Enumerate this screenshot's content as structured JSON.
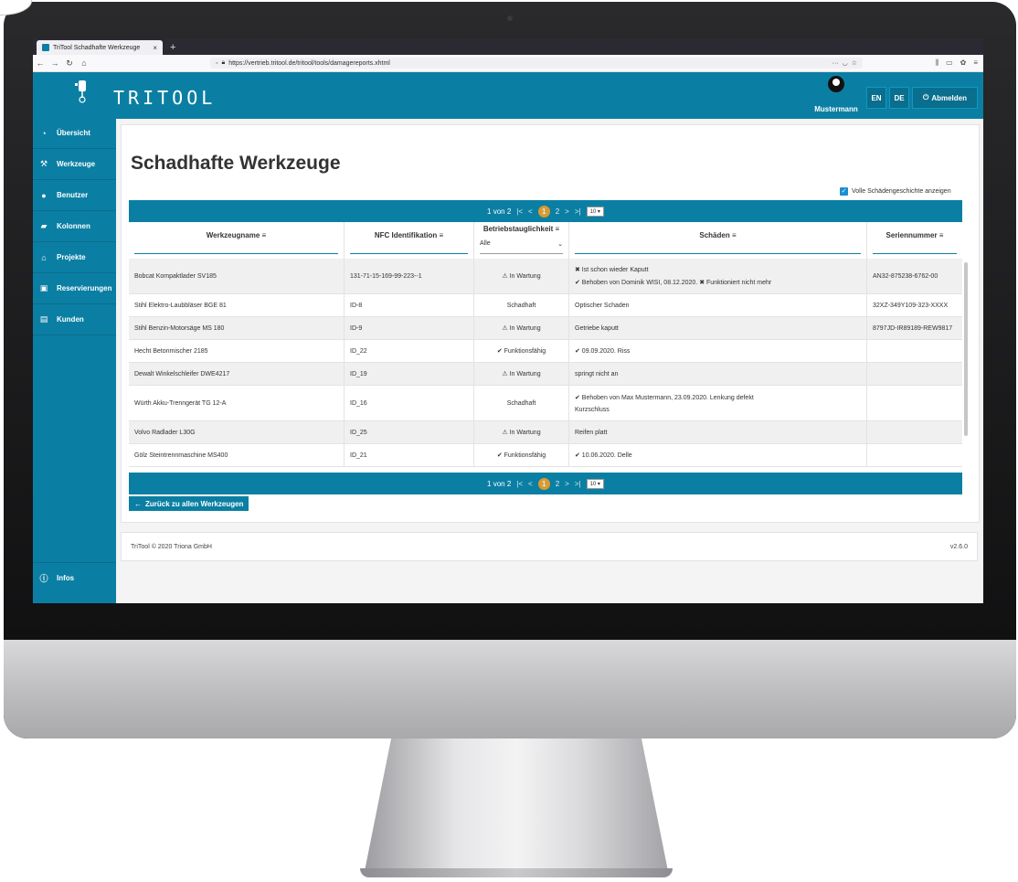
{
  "browser": {
    "tab_title": "TriTool Schadhafte Werkzeuge",
    "tab_close": "×",
    "new_tab": "+",
    "url": "https://vertrieb.tritool.de/tritool/tools/damagereports.xhtml"
  },
  "header": {
    "brand": "TRITOOL",
    "user": "Mustermann",
    "lang_en": "EN",
    "lang_de": "DE",
    "logout": "Abmelden"
  },
  "sidebar": {
    "items": [
      {
        "label": "Übersicht",
        "icon": "dashboard-icon"
      },
      {
        "label": "Werkzeuge",
        "icon": "wrench-icon"
      },
      {
        "label": "Benutzer",
        "icon": "user-icon"
      },
      {
        "label": "Kolonnen",
        "icon": "truck-icon"
      },
      {
        "label": "Projekte",
        "icon": "building-icon"
      },
      {
        "label": "Reservierungen",
        "icon": "lock-icon"
      },
      {
        "label": "Kunden",
        "icon": "id-card-icon"
      }
    ],
    "info": "Infos"
  },
  "page": {
    "title": "Schadhafte Werkzeuge",
    "full_history": "Volle Schädengeschichte anzeigen",
    "back": "Zurück zu allen Werkzeugen"
  },
  "pager": {
    "label": "1 von 2",
    "first": "|<",
    "prev": "<",
    "page1": "1",
    "page2": "2",
    "next": ">",
    "last": ">|",
    "rows_per_page": "10"
  },
  "table": {
    "columns": [
      "Werkzeugname",
      "NFC Identifikation",
      "Betriebstauglichkeit",
      "Schäden",
      "Seriennummer"
    ],
    "status_filter": "Alle",
    "rows": [
      {
        "name": "Bobcat Kompaktlader SV185",
        "nfc": "131-71-15-169-99-223--1",
        "status": "⚠ In Wartung",
        "damage1": "✖ Ist schon wieder Kaputt",
        "damage2": "✔ Behoben von Dominik WISI, 08.12.2020. ✖ Funktioniert nicht mehr",
        "serial": "AN32-875238-6762-00"
      },
      {
        "name": "Stihl Elektro-Laubbläser BGE 81",
        "nfc": "ID-8",
        "status": "Schadhaft",
        "damage1": "Optischer Schaden",
        "damage2": "",
        "serial": "32XZ-349Y109-323-XXXX"
      },
      {
        "name": "Stihl Benzin-Motorsäge MS 180",
        "nfc": "ID-9",
        "status": "⚠ In Wartung",
        "damage1": "Getriebe kaputt",
        "damage2": "",
        "serial": "8797JD-IR89189-REW9817"
      },
      {
        "name": "Hecht Betonmischer 2185",
        "nfc": "ID_22",
        "status": "✔ Funktionsfähig",
        "damage1": "✔ 09.09.2020. Riss",
        "damage2": "",
        "serial": ""
      },
      {
        "name": "Dewalt Winkelschleifer DWE4217",
        "nfc": "ID_19",
        "status": "⚠ In Wartung",
        "damage1": "springt nicht an",
        "damage2": "",
        "serial": ""
      },
      {
        "name": "Würth Akku-Trenngerät TG 12-A",
        "nfc": "ID_16",
        "status": "Schadhaft",
        "damage1": "✔ Behoben von Max Mustermann, 23.09.2020. Lenkung defekt",
        "damage2": "Kurzschluss",
        "serial": ""
      },
      {
        "name": "Volvo Radlader L30G",
        "nfc": "ID_25",
        "status": "⚠ In Wartung",
        "damage1": "Reifen platt",
        "damage2": "",
        "serial": ""
      },
      {
        "name": "Gölz Steintrennmaschine MS400",
        "nfc": "ID_21",
        "status": "✔ Funktionsfähig",
        "damage1": "✔ 10.06.2020. Delle",
        "damage2": "",
        "serial": ""
      }
    ]
  },
  "footer": {
    "copyright": "TriTool © 2020 Triona GmbH",
    "version": "v2.6.0"
  },
  "colors": {
    "brand": "#0b7fa3",
    "accent": "#ff9f1a"
  }
}
